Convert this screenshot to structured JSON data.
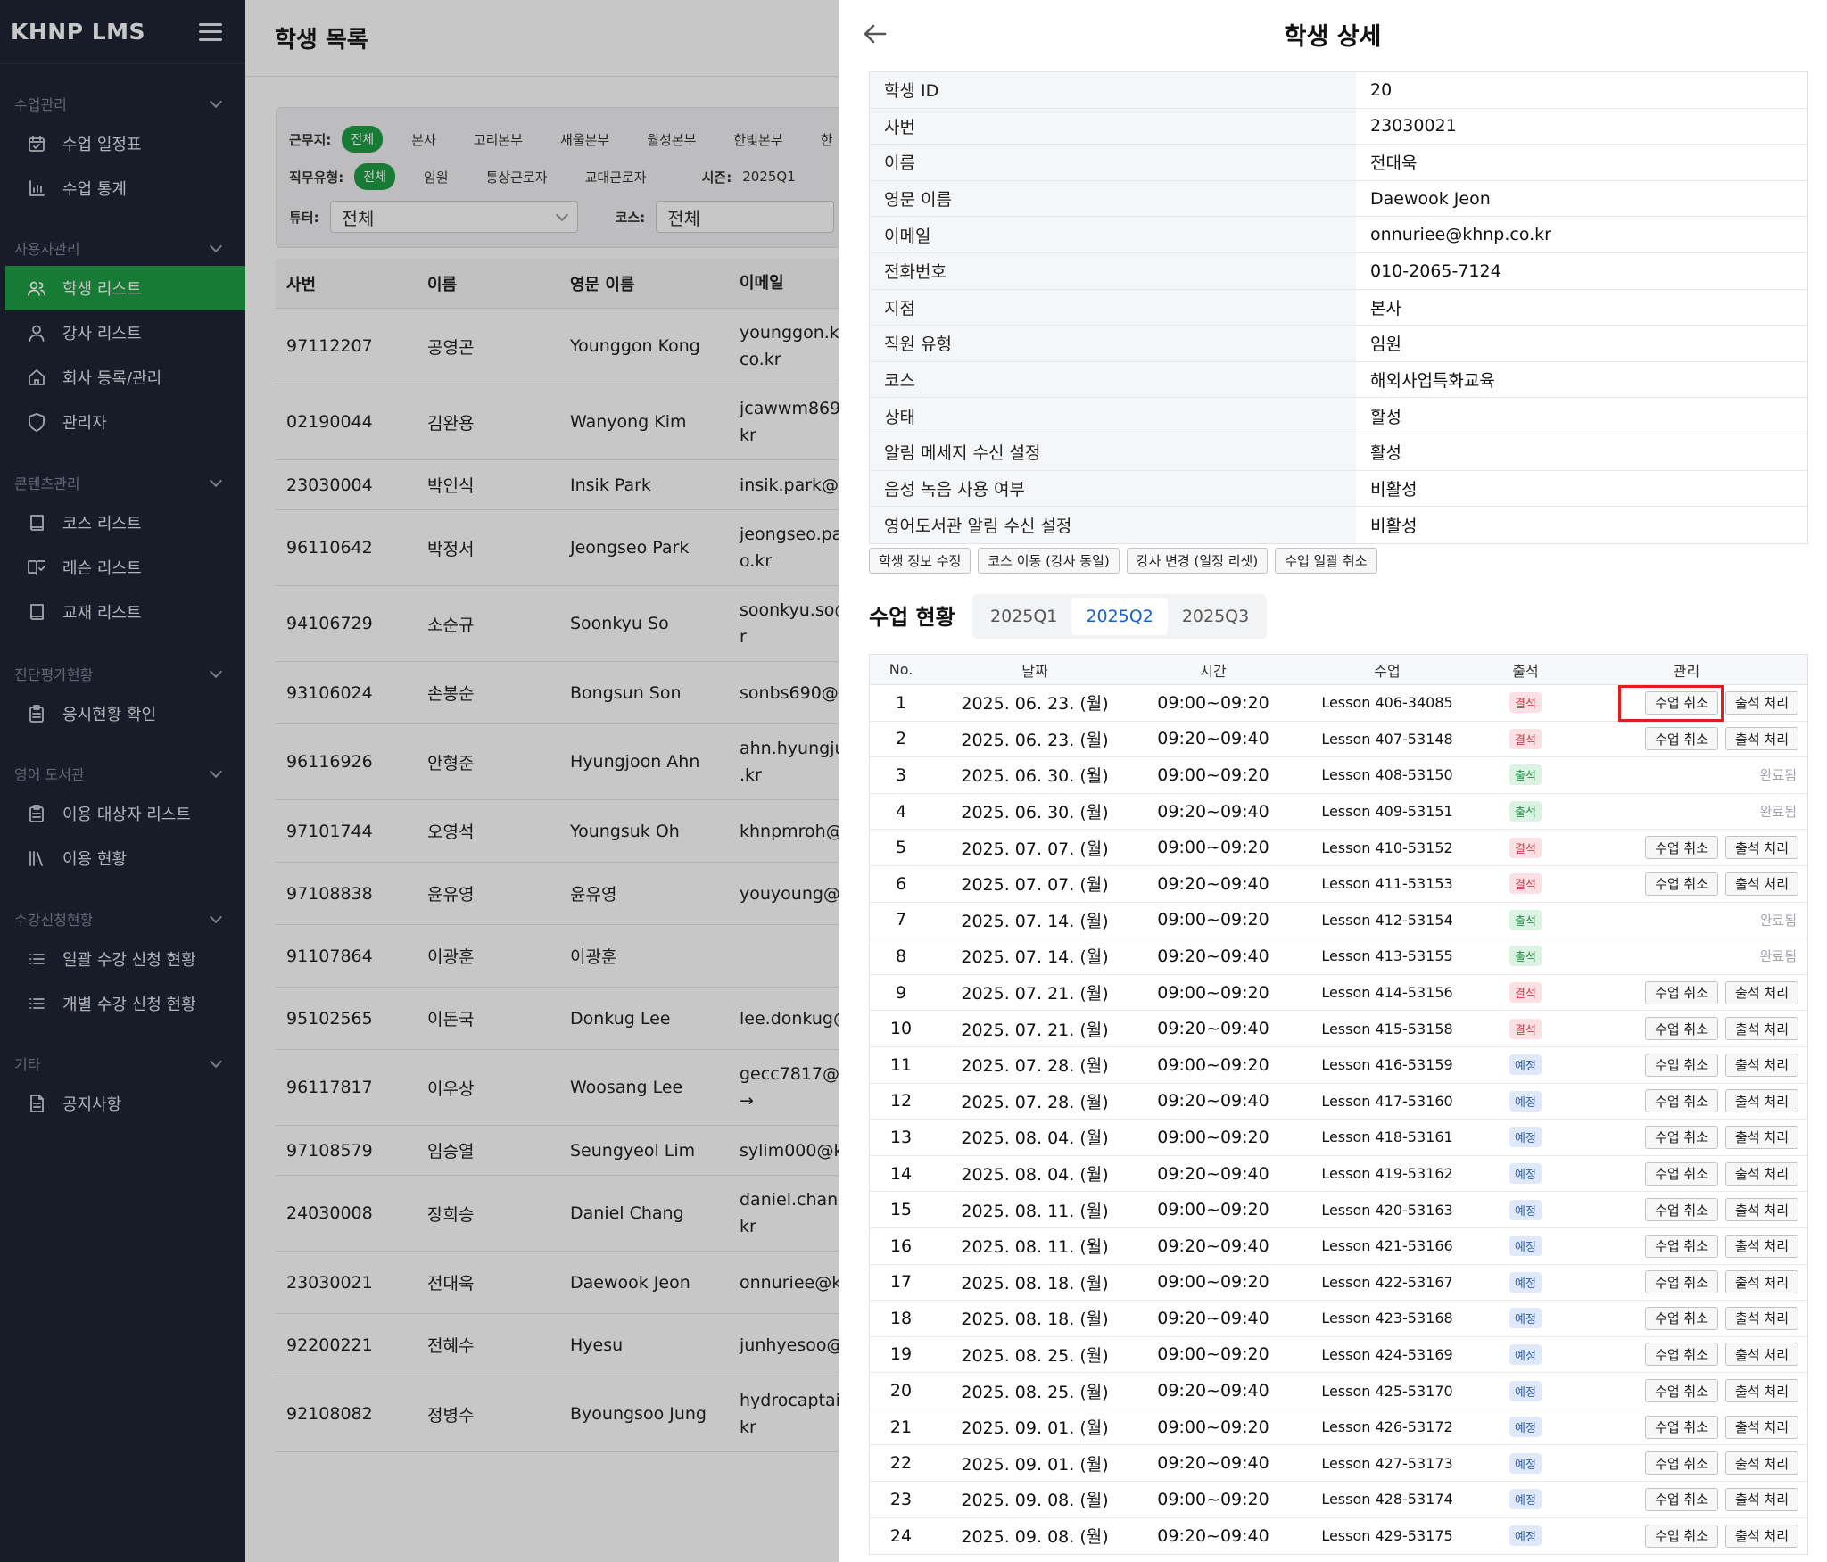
{
  "sidebar": {
    "brand": "KHNP LMS",
    "sections": [
      {
        "title": "수업관리",
        "items": [
          {
            "label": "수업 일정표",
            "icon": "calendar-icon"
          },
          {
            "label": "수업 통계",
            "icon": "stats-icon"
          }
        ]
      },
      {
        "title": "사용자관리",
        "items": [
          {
            "label": "학생 리스트",
            "icon": "users-icon",
            "active": true
          },
          {
            "label": "강사 리스트",
            "icon": "user-icon"
          },
          {
            "label": "회사 등록/관리",
            "icon": "home-icon"
          },
          {
            "label": "관리자",
            "icon": "shield-icon"
          }
        ]
      },
      {
        "title": "콘텐츠관리",
        "items": [
          {
            "label": "코스 리스트",
            "icon": "book-icon"
          },
          {
            "label": "레슨 리스트",
            "icon": "book-open-icon"
          },
          {
            "label": "교재 리스트",
            "icon": "book-icon"
          }
        ]
      },
      {
        "title": "진단평가현황",
        "items": [
          {
            "label": "응시현황 확인",
            "icon": "clipboard-icon"
          }
        ]
      },
      {
        "title": "영어 도서관",
        "items": [
          {
            "label": "이용 대상자 리스트",
            "icon": "clipboard-icon"
          },
          {
            "label": "이용 현황",
            "icon": "library-icon"
          }
        ]
      },
      {
        "title": "수강신청현황",
        "items": [
          {
            "label": "일괄 수강 신청 현황",
            "icon": "list-icon"
          },
          {
            "label": "개별 수강 신청 현황",
            "icon": "list-icon"
          }
        ]
      },
      {
        "title": "기타",
        "items": [
          {
            "label": "공지사항",
            "icon": "document-icon"
          }
        ]
      }
    ]
  },
  "main": {
    "title": "학생 목록",
    "filters": {
      "workplace_label": "근무지:",
      "workplace_options": [
        "전체",
        "본사",
        "고리본부",
        "새울본부",
        "월성본부",
        "한빛본부",
        "한"
      ],
      "jobtype_label": "직무유형:",
      "jobtype_options": [
        "전체",
        "임원",
        "통상근로자",
        "교대근로자"
      ],
      "season_label": "시즌:",
      "season_value": "2025Q1",
      "tutor_label": "튜터:",
      "tutor_value": "전체",
      "course_label": "코스:",
      "course_value": "전체"
    },
    "table": {
      "headers": [
        "사번",
        "이름",
        "영문 이름",
        "이메일"
      ],
      "rows": [
        {
          "id": "97112207",
          "name": "공영곤",
          "en": "Younggon Kong",
          "email": "younggon.kc\nco.kr"
        },
        {
          "id": "02190044",
          "name": "김완용",
          "en": "Wanyong Kim",
          "email": "jcawwm869\nkr"
        },
        {
          "id": "23030004",
          "name": "박인식",
          "en": "Insik Park",
          "email": "insik.park@k"
        },
        {
          "id": "96110642",
          "name": "박정서",
          "en": "Jeongseo Park",
          "email": "jeongseo.pa\no.kr"
        },
        {
          "id": "94106729",
          "name": "소순규",
          "en": "Soonkyu So",
          "email": "soonkyu.so@\nr"
        },
        {
          "id": "93106024",
          "name": "손봉순",
          "en": "Bongsun Son",
          "email": "sonbs690@"
        },
        {
          "id": "96116926",
          "name": "안형준",
          "en": "Hyungjoon Ahn",
          "email": "ahn.hyungju\n.kr"
        },
        {
          "id": "97101744",
          "name": "오영석",
          "en": "Youngsuk Oh",
          "email": "khnpmroh@"
        },
        {
          "id": "97108838",
          "name": "윤유영",
          "en": "윤유영",
          "email": "youyoung@k"
        },
        {
          "id": "91107864",
          "name": "이광훈",
          "en": "이광훈",
          "email": ""
        },
        {
          "id": "95102565",
          "name": "이돈국",
          "en": "Donkug Lee",
          "email": "lee.donkug@"
        },
        {
          "id": "96117817",
          "name": "이우상",
          "en": "Woosang Lee",
          "email": "gecc7817@k\n→"
        },
        {
          "id": "97108579",
          "name": "임승열",
          "en": "Seungyeol Lim",
          "email": "sylim000@k"
        },
        {
          "id": "24030008",
          "name": "장희승",
          "en": "Daniel Chang",
          "email": "daniel.chang\nkr"
        },
        {
          "id": "23030021",
          "name": "전대욱",
          "en": "Daewook Jeon",
          "email": "onnuriee@kl"
        },
        {
          "id": "92200221",
          "name": "전혜수",
          "en": "Hyesu",
          "email": "junhyesoo@"
        },
        {
          "id": "92108082",
          "name": "정병수",
          "en": "Byoungsoo Jung",
          "email": "hydrocaptair\nkr"
        }
      ]
    }
  },
  "drawer": {
    "title": "학생 상세",
    "info": [
      {
        "k": "학생 ID",
        "v": "20"
      },
      {
        "k": "사번",
        "v": "23030021"
      },
      {
        "k": "이름",
        "v": "전대욱"
      },
      {
        "k": "영문 이름",
        "v": "Daewook Jeon"
      },
      {
        "k": "이메일",
        "v": "onnuriee@khnp.co.kr"
      },
      {
        "k": "전화번호",
        "v": "010-2065-7124"
      },
      {
        "k": "지점",
        "v": "본사"
      },
      {
        "k": "직원 유형",
        "v": "임원"
      },
      {
        "k": "코스",
        "v": "해외사업특화교육"
      },
      {
        "k": "상태",
        "v": "활성"
      },
      {
        "k": "알림 메세지 수신 설정",
        "v": "활성"
      },
      {
        "k": "음성 녹음 사용 여부",
        "v": "비활성"
      },
      {
        "k": "영어도서관 알림 수신 설정",
        "v": "비활성"
      }
    ],
    "actions": [
      "학생 정보 수정",
      "코스 이동 (강사 동일)",
      "강사 변경 (일정 리셋)",
      "수업 일괄 취소"
    ],
    "status_title": "수업 현황",
    "quarters": [
      "2025Q1",
      "2025Q2",
      "2025Q3"
    ],
    "active_quarter": "2025Q2",
    "schedule_headers": [
      "No.",
      "날짜",
      "시간",
      "수업",
      "출석",
      "관리"
    ],
    "cancel_label": "수업 취소",
    "attend_label": "출석 처리",
    "done_label": "완료됨",
    "status_labels": {
      "absent": "결석",
      "present": "출석",
      "scheduled": "예정"
    },
    "colors": {
      "absent_text": "#d43a4a",
      "absent_bg": "#fbe1e3",
      "present_text": "#1e8f43",
      "present_bg": "#dcf2e2",
      "scheduled_text": "#2b5fb4",
      "scheduled_bg": "#dfe9f9",
      "highlight": "#e11d1d",
      "accent": "#1e9e45"
    },
    "schedule": [
      {
        "no": "1",
        "date": "2025. 06. 23. (월)",
        "time": "09:00~09:20",
        "lesson": "Lesson 406-34085",
        "status": "absent"
      },
      {
        "no": "2",
        "date": "2025. 06. 23. (월)",
        "time": "09:20~09:40",
        "lesson": "Lesson 407-53148",
        "status": "absent"
      },
      {
        "no": "3",
        "date": "2025. 06. 30. (월)",
        "time": "09:00~09:20",
        "lesson": "Lesson 408-53150",
        "status": "present"
      },
      {
        "no": "4",
        "date": "2025. 06. 30. (월)",
        "time": "09:20~09:40",
        "lesson": "Lesson 409-53151",
        "status": "present"
      },
      {
        "no": "5",
        "date": "2025. 07. 07. (월)",
        "time": "09:00~09:20",
        "lesson": "Lesson 410-53152",
        "status": "absent"
      },
      {
        "no": "6",
        "date": "2025. 07. 07. (월)",
        "time": "09:20~09:40",
        "lesson": "Lesson 411-53153",
        "status": "absent"
      },
      {
        "no": "7",
        "date": "2025. 07. 14. (월)",
        "time": "09:00~09:20",
        "lesson": "Lesson 412-53154",
        "status": "present"
      },
      {
        "no": "8",
        "date": "2025. 07. 14. (월)",
        "time": "09:20~09:40",
        "lesson": "Lesson 413-53155",
        "status": "present"
      },
      {
        "no": "9",
        "date": "2025. 07. 21. (월)",
        "time": "09:00~09:20",
        "lesson": "Lesson 414-53156",
        "status": "absent"
      },
      {
        "no": "10",
        "date": "2025. 07. 21. (월)",
        "time": "09:20~09:40",
        "lesson": "Lesson 415-53158",
        "status": "absent"
      },
      {
        "no": "11",
        "date": "2025. 07. 28. (월)",
        "time": "09:00~09:20",
        "lesson": "Lesson 416-53159",
        "status": "scheduled"
      },
      {
        "no": "12",
        "date": "2025. 07. 28. (월)",
        "time": "09:20~09:40",
        "lesson": "Lesson 417-53160",
        "status": "scheduled"
      },
      {
        "no": "13",
        "date": "2025. 08. 04. (월)",
        "time": "09:00~09:20",
        "lesson": "Lesson 418-53161",
        "status": "scheduled"
      },
      {
        "no": "14",
        "date": "2025. 08. 04. (월)",
        "time": "09:20~09:40",
        "lesson": "Lesson 419-53162",
        "status": "scheduled"
      },
      {
        "no": "15",
        "date": "2025. 08. 11. (월)",
        "time": "09:00~09:20",
        "lesson": "Lesson 420-53163",
        "status": "scheduled"
      },
      {
        "no": "16",
        "date": "2025. 08. 11. (월)",
        "time": "09:20~09:40",
        "lesson": "Lesson 421-53166",
        "status": "scheduled"
      },
      {
        "no": "17",
        "date": "2025. 08. 18. (월)",
        "time": "09:00~09:20",
        "lesson": "Lesson 422-53167",
        "status": "scheduled"
      },
      {
        "no": "18",
        "date": "2025. 08. 18. (월)",
        "time": "09:20~09:40",
        "lesson": "Lesson 423-53168",
        "status": "scheduled"
      },
      {
        "no": "19",
        "date": "2025. 08. 25. (월)",
        "time": "09:00~09:20",
        "lesson": "Lesson 424-53169",
        "status": "scheduled"
      },
      {
        "no": "20",
        "date": "2025. 08. 25. (월)",
        "time": "09:20~09:40",
        "lesson": "Lesson 425-53170",
        "status": "scheduled"
      },
      {
        "no": "21",
        "date": "2025. 09. 01. (월)",
        "time": "09:00~09:20",
        "lesson": "Lesson 426-53172",
        "status": "scheduled"
      },
      {
        "no": "22",
        "date": "2025. 09. 01. (월)",
        "time": "09:20~09:40",
        "lesson": "Lesson 427-53173",
        "status": "scheduled"
      },
      {
        "no": "23",
        "date": "2025. 09. 08. (월)",
        "time": "09:00~09:20",
        "lesson": "Lesson 428-53174",
        "status": "scheduled"
      },
      {
        "no": "24",
        "date": "2025. 09. 08. (월)",
        "time": "09:20~09:40",
        "lesson": "Lesson 429-53175",
        "status": "scheduled"
      }
    ]
  }
}
